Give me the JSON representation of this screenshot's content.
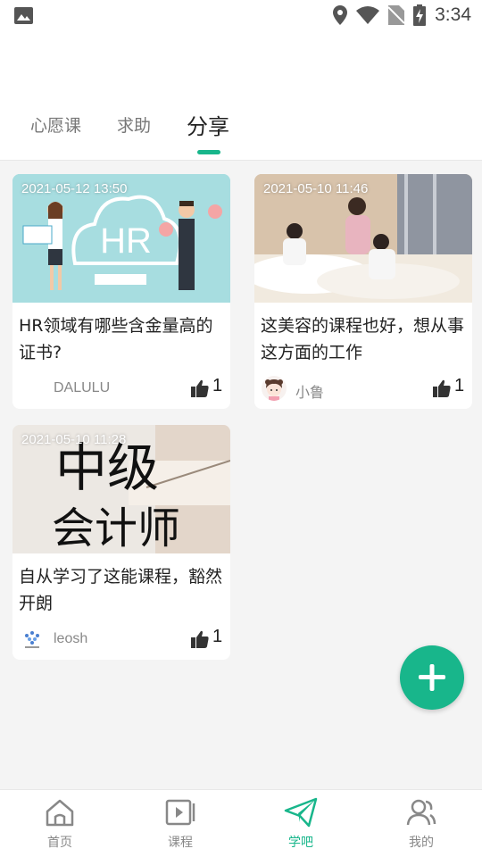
{
  "status_bar": {
    "time": "3:34"
  },
  "tabs": [
    {
      "label": "心愿课",
      "active": false
    },
    {
      "label": "求助",
      "active": false
    },
    {
      "label": "分享",
      "active": true
    }
  ],
  "posts": [
    {
      "date": "2021-05-12 13:50",
      "title": "HR领域有哪些含金量高的证书?",
      "author": "DALULU",
      "likes": "1",
      "image_text": "HR"
    },
    {
      "date": "2021-05-10 11:46",
      "title": "这美容的课程也好，想从事这方面的工作",
      "author": "小鲁",
      "likes": "1"
    },
    {
      "date": "2021-05-10 11:28",
      "title": "自从学习了这能课程，豁然开朗",
      "author": "leosh",
      "likes": "1",
      "image_text_line1": "中级",
      "image_text_line2": "会计师"
    }
  ],
  "bottom_nav": [
    {
      "label": "首页",
      "icon": "home-icon",
      "active": false
    },
    {
      "label": "课程",
      "icon": "video-course-icon",
      "active": false
    },
    {
      "label": "学吧",
      "icon": "paper-plane-icon",
      "active": true
    },
    {
      "label": "我的",
      "icon": "profile-icon",
      "active": false
    }
  ],
  "colors": {
    "accent": "#18b68b",
    "background": "#f4f4f4"
  }
}
